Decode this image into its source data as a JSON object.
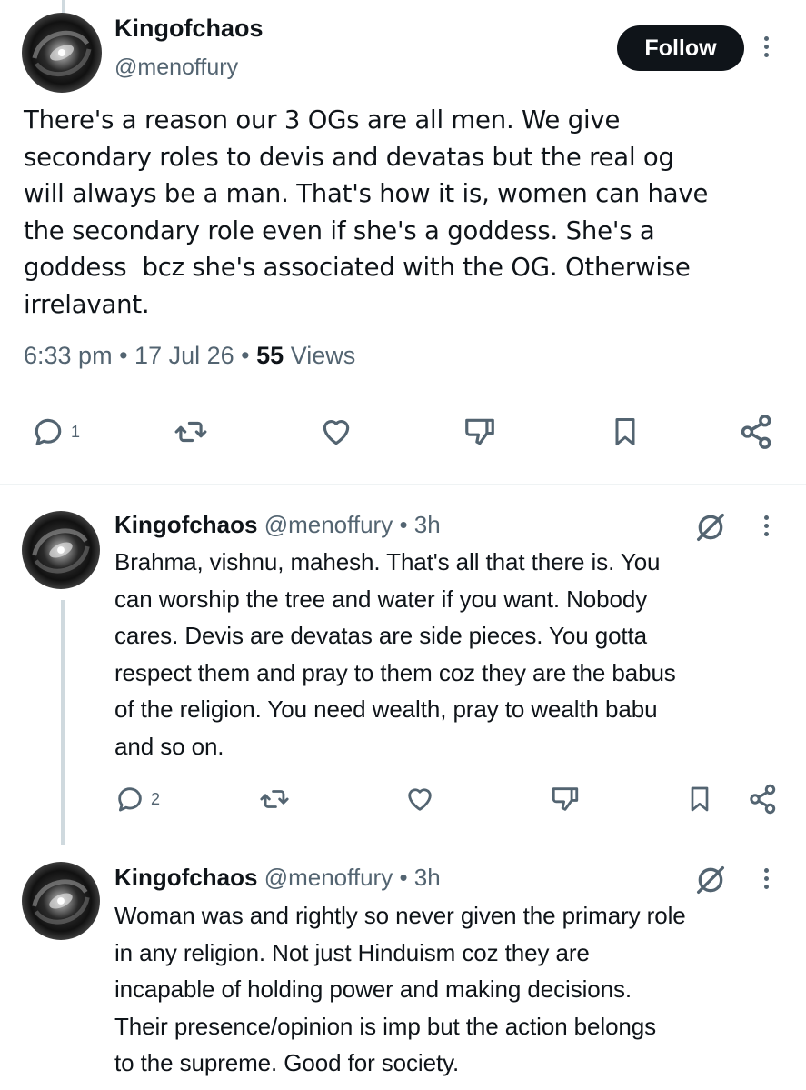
{
  "main_tweet": {
    "name": "Kingofchaos",
    "handle": "@menoffury",
    "follow_label": "Follow",
    "text": "There's a reason our 3 OGs are all men. We give\nsecondary roles to devis and devatas but the real og\nwill always be a man. That's how it is, women can have\nthe secondary role even if she's a goddess. She's a\ngoddess  bcz she's associated with the OG. Otherwise\nirrelavant.",
    "time": "6:33 pm",
    "date": "17 Jul 26",
    "views_count": "55",
    "views_label": "Views",
    "reply_count": "1"
  },
  "replies": [
    {
      "name": "Kingofchaos",
      "handle": "@menoffury",
      "age": "3h",
      "text": "Brahma, vishnu, mahesh. That's all that there is. You\ncan worship the tree and water if you want. Nobody\ncares. Devis are devatas are side pieces. You gotta\nrespect them and pray to them coz they are the babus\nof the religion. You need wealth, pray to wealth babu\nand so on.",
      "reply_count": "2"
    },
    {
      "name": "Kingofchaos",
      "handle": "@menoffury",
      "age": "3h",
      "text": "Woman was and rightly so never given the primary role\nin any religion. Not just Hinduism coz they are\nincapable of holding power and making decisions.\nTheir presence/opinion is imp but the action belongs\nto the supreme. Good for society."
    }
  ],
  "colors": {
    "text": "#0f1419",
    "secondary": "#536471",
    "thread_line": "#cfd9de",
    "follow_bg": "#0f1419"
  },
  "icons": [
    "reply-icon",
    "repost-icon",
    "like-icon",
    "dislike-icon",
    "bookmark-icon",
    "share-icon",
    "grok-icon",
    "more-icon"
  ]
}
